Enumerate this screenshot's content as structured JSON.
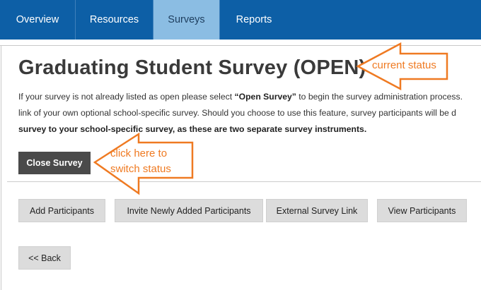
{
  "nav": {
    "tabs": [
      {
        "label": "Overview"
      },
      {
        "label": "Resources"
      },
      {
        "label": "Surveys"
      },
      {
        "label": "Reports"
      }
    ]
  },
  "page": {
    "title": "Graduating Student Survey (OPEN)",
    "desc_line1_a": "If your survey is not already listed as open please select ",
    "desc_line1_bold": "“Open Survey”",
    "desc_line1_b": " to begin the survey administration process.",
    "desc_line2": "link of your own optional school-specific survey. Should you choose to use this feature, survey participants will be d",
    "desc_line3_bold": "survey to your school-specific survey, as these are two separate survey instruments."
  },
  "buttons": {
    "close_survey": "Close Survey",
    "add_participants": "Add Participants",
    "invite_new": "Invite Newly Added Participants",
    "external_link": "External Survey Link",
    "view_participants": "View Participants",
    "back": "<< Back"
  },
  "annotations": {
    "current_status": "current status",
    "click_line1": "click here to",
    "click_line2": "switch status"
  },
  "colors": {
    "nav_bg": "#0d5fa6",
    "nav_active": "#8bbde3",
    "annotation": "#ef7a22"
  }
}
